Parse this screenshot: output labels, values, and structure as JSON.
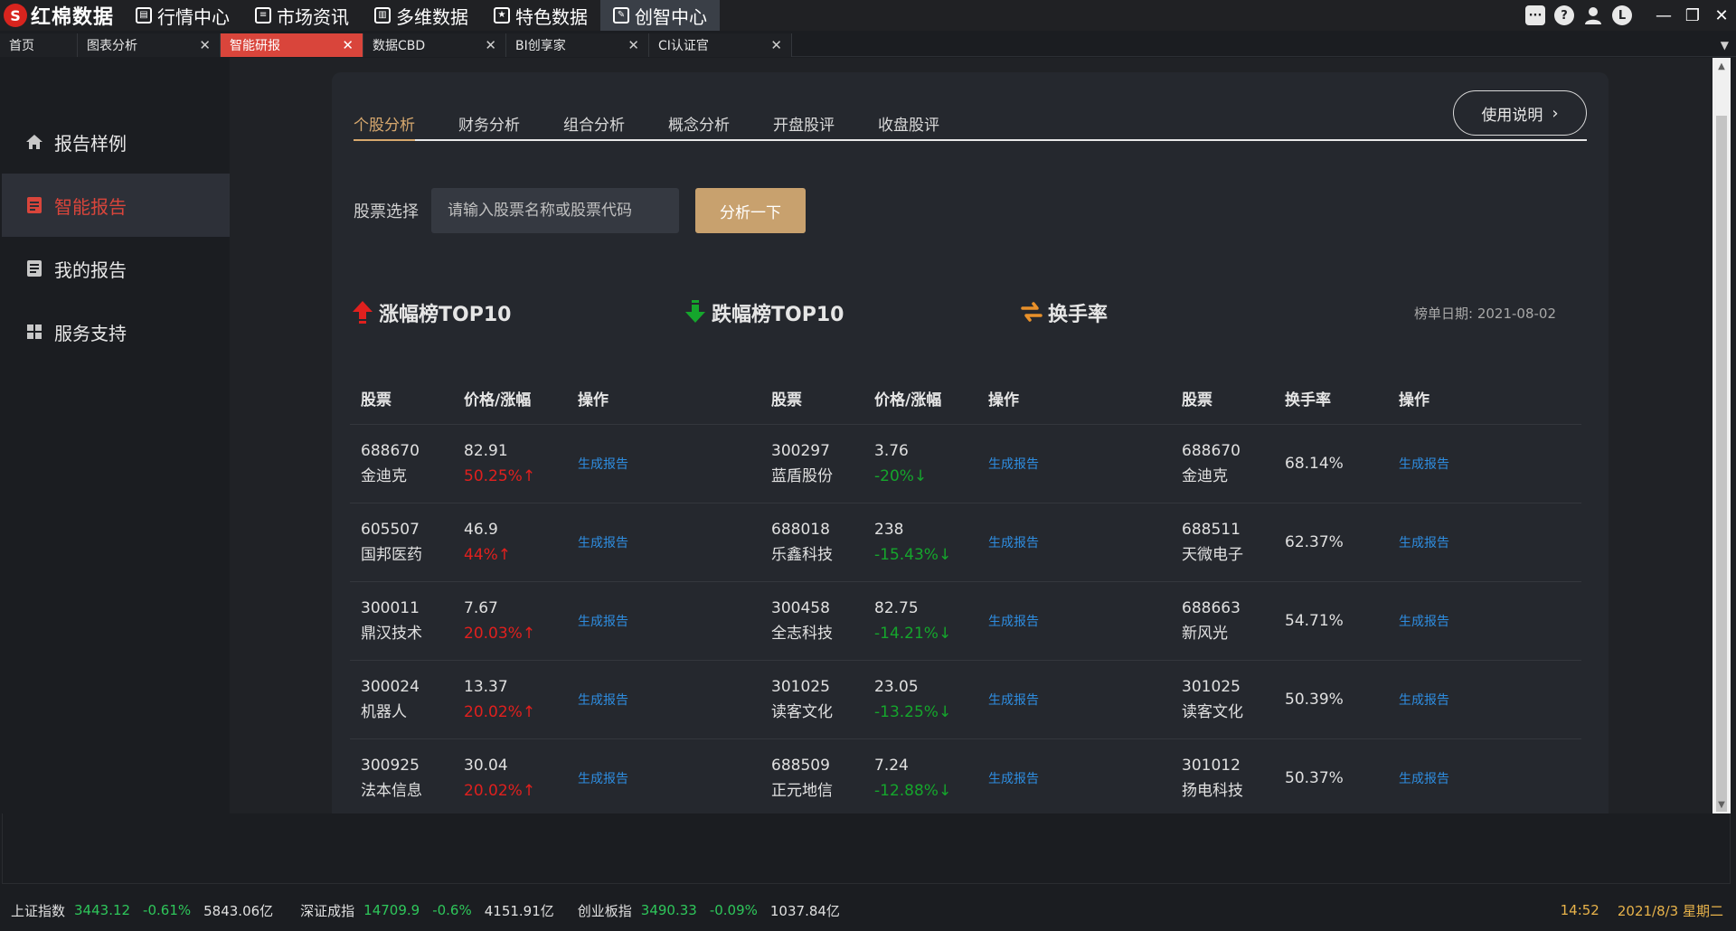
{
  "app": {
    "logo_text": "红棉数据",
    "menu": [
      {
        "label": "行情中心",
        "icon": "chart-icon"
      },
      {
        "label": "市场资讯",
        "icon": "news-icon"
      },
      {
        "label": "多维数据",
        "icon": "bars-icon"
      },
      {
        "label": "特色数据",
        "icon": "star-icon"
      },
      {
        "label": "创智中心",
        "icon": "tools-icon",
        "active": true
      }
    ],
    "user_initial": "L"
  },
  "tabs": [
    {
      "label": "首页"
    },
    {
      "label": "图表分析"
    },
    {
      "label": "智能研报",
      "active": true
    },
    {
      "label": "数据CBD"
    },
    {
      "label": "BI创享家"
    },
    {
      "label": "CI认证官"
    }
  ],
  "sidebar": {
    "items": [
      {
        "label": "报告样例",
        "icon": "home-icon"
      },
      {
        "label": "智能报告",
        "icon": "report-icon",
        "active": true
      },
      {
        "label": "我的报告",
        "icon": "document-icon"
      },
      {
        "label": "服务支持",
        "icon": "grid-icon"
      }
    ]
  },
  "subtabs": [
    {
      "label": "个股分析",
      "active": true
    },
    {
      "label": "财务分析"
    },
    {
      "label": "组合分析"
    },
    {
      "label": "概念分析"
    },
    {
      "label": "开盘股评"
    },
    {
      "label": "收盘股评"
    }
  ],
  "help_button": "使用说明",
  "stock_select": {
    "label": "股票选择",
    "placeholder": "请输入股票名称或股票代码",
    "button": "分析一下"
  },
  "rank_date": "榜单日期: 2021-08-02",
  "gainers": {
    "title": "涨幅榜TOP10",
    "headers": [
      "股票",
      "价格/涨幅",
      "操作"
    ],
    "rows": [
      {
        "code": "688670",
        "name": "金迪克",
        "price": "82.91",
        "pct": "50.25%↑"
      },
      {
        "code": "605507",
        "name": "国邦医药",
        "price": "46.9",
        "pct": "44%↑"
      },
      {
        "code": "300011",
        "name": "鼎汉技术",
        "price": "7.67",
        "pct": "20.03%↑"
      },
      {
        "code": "300024",
        "name": "机器人",
        "price": "13.37",
        "pct": "20.02%↑"
      },
      {
        "code": "300925",
        "name": "法本信息",
        "price": "30.04",
        "pct": "20.02%↑"
      }
    ]
  },
  "losers": {
    "title": "跌幅榜TOP10",
    "headers": [
      "股票",
      "价格/涨幅",
      "操作"
    ],
    "rows": [
      {
        "code": "300297",
        "name": "蓝盾股份",
        "price": "3.76",
        "pct": "-20%↓"
      },
      {
        "code": "688018",
        "name": "乐鑫科技",
        "price": "238",
        "pct": "-15.43%↓"
      },
      {
        "code": "300458",
        "name": "全志科技",
        "price": "82.75",
        "pct": "-14.21%↓"
      },
      {
        "code": "301025",
        "name": "读客文化",
        "price": "23.05",
        "pct": "-13.25%↓"
      },
      {
        "code": "688509",
        "name": "正元地信",
        "price": "7.24",
        "pct": "-12.88%↓"
      }
    ]
  },
  "turnover": {
    "title": "换手率",
    "headers": [
      "股票",
      "换手率",
      "操作"
    ],
    "rows": [
      {
        "code": "688670",
        "name": "金迪克",
        "rate": "68.14%"
      },
      {
        "code": "688511",
        "name": "天微电子",
        "rate": "62.37%"
      },
      {
        "code": "688663",
        "name": "新风光",
        "rate": "54.71%"
      },
      {
        "code": "301025",
        "name": "读客文化",
        "rate": "50.39%"
      },
      {
        "code": "301012",
        "name": "扬电科技",
        "rate": "50.37%"
      }
    ]
  },
  "action_label": "生成报告",
  "status": {
    "indices": [
      {
        "name": "上证指数",
        "value": "3443.12",
        "change": "-0.61%",
        "volume": "5843.06亿"
      },
      {
        "name": "深证成指",
        "value": "14709.9",
        "change": "-0.6%",
        "volume": "4151.91亿"
      },
      {
        "name": "创业板指",
        "value": "3490.33",
        "change": "-0.09%",
        "volume": "1037.84亿"
      }
    ],
    "time": "14:52",
    "date": "2021/8/3 星期二"
  },
  "colors": {
    "accent_red": "#d9453b",
    "gold": "#c8a16e",
    "up": "#e0201e",
    "down": "#15a62c",
    "link": "#2e8de0"
  }
}
